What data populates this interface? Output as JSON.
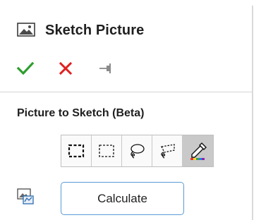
{
  "header": {
    "title": "Sketch Picture",
    "icon": "image-picture-icon"
  },
  "actions": [
    {
      "name": "ok-button",
      "icon": "checkmark-icon",
      "color": "#2e9e2e"
    },
    {
      "name": "cancel-button",
      "icon": "close-x-icon",
      "color": "#e02020"
    },
    {
      "name": "pin-button",
      "icon": "pushpin-icon",
      "color": "#8a8a8a"
    }
  ],
  "section": {
    "title": "Picture to Sketch (Beta)"
  },
  "tools": [
    {
      "name": "tool-rectangle-select",
      "icon": "rectangle-select-icon",
      "active": false
    },
    {
      "name": "tool-dashed-rectangle-select",
      "icon": "dashed-rectangle-select-icon",
      "active": false
    },
    {
      "name": "tool-lasso-select",
      "icon": "lasso-select-icon",
      "active": false
    },
    {
      "name": "tool-polygon-lasso-select",
      "icon": "polygon-lasso-icon",
      "active": false
    },
    {
      "name": "tool-color-picker",
      "icon": "eyedropper-icon",
      "active": true
    }
  ],
  "calculate": {
    "label": "Calculate",
    "icon": "picture-convert-icon"
  },
  "colors": {
    "accent_border": "#5b9bd5",
    "active_tool_bg": "#c9c9c9"
  }
}
